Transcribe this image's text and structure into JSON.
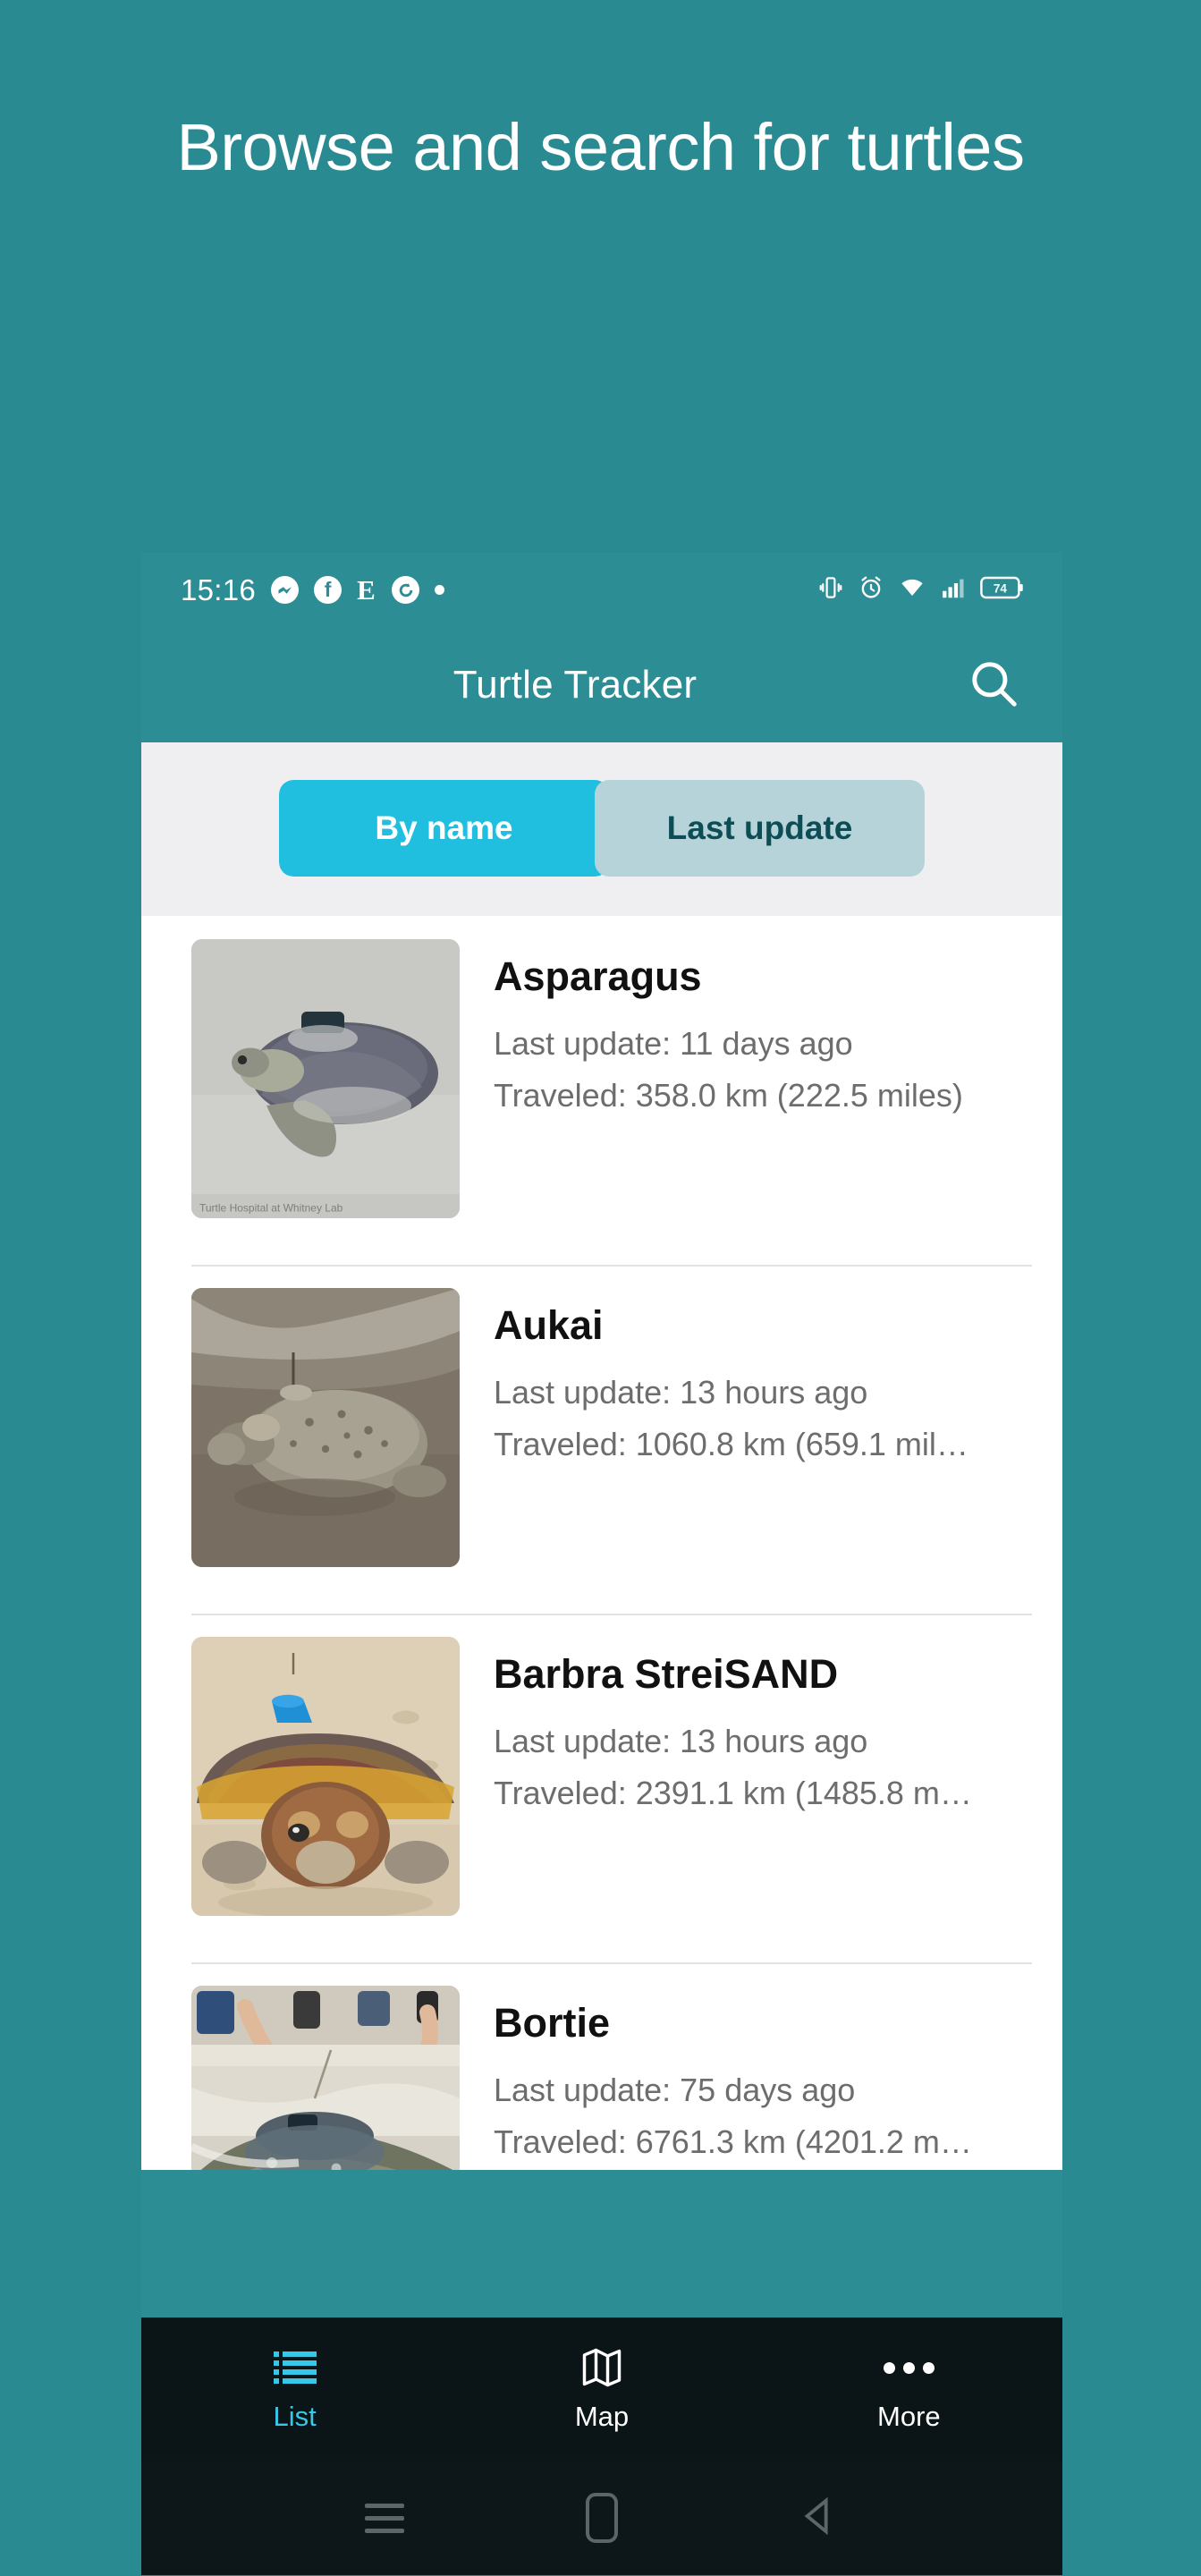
{
  "promo": {
    "headline": "Browse and search for turtles",
    "background_color": "#2a8a92"
  },
  "statusbar": {
    "time": "15:16",
    "left_icons": [
      "messenger-icon",
      "facebook-icon",
      "e-icon",
      "c-icon",
      "dot-icon"
    ],
    "right_icons": [
      "vibrate-icon",
      "alarm-icon",
      "wifi-icon",
      "signal-icon",
      "battery-icon"
    ],
    "battery_level": "74"
  },
  "appbar": {
    "title": "Turtle Tracker",
    "search_icon": "search-icon"
  },
  "segment": {
    "options": [
      {
        "label": "By name",
        "active": true
      },
      {
        "label": "Last update",
        "active": false
      }
    ],
    "active_color": "#20bfdf",
    "inactive_color": "#b6d3da",
    "band_color": "#efeff1"
  },
  "list": {
    "items": [
      {
        "name": "Asparagus",
        "last_update": "Last update: 11 days ago",
        "traveled": "Traveled: 358.0 km (222.5 miles)",
        "thumb": "turtle-with-tracker-on-pale-sand"
      },
      {
        "name": "Aukai",
        "last_update": "Last update: 13 hours ago",
        "traveled": "Traveled: 1060.8 km (659.1 mil…",
        "thumb": "grey-turtle-on-wet-beach"
      },
      {
        "name": "Barbra StreiSAND",
        "last_update": "Last update: 13 hours ago",
        "traveled": "Traveled: 2391.1 km (1485.8 m…",
        "thumb": "loggerhead-turtle-facing-camera"
      },
      {
        "name": "Bortie",
        "last_update": "Last update: 75 days ago",
        "traveled": "Traveled: 6761.3 km (4201.2 m…",
        "thumb": "turtle-release-into-surf"
      }
    ]
  },
  "bottomnav": {
    "items": [
      {
        "label": "List",
        "icon": "list-icon",
        "active": true
      },
      {
        "label": "Map",
        "icon": "map-icon",
        "active": false
      },
      {
        "label": "More",
        "icon": "more-dots-icon",
        "active": false
      }
    ],
    "active_color": "#36c8e8"
  },
  "sysnav": {
    "buttons": [
      "recents-icon",
      "home-icon",
      "back-icon"
    ]
  }
}
